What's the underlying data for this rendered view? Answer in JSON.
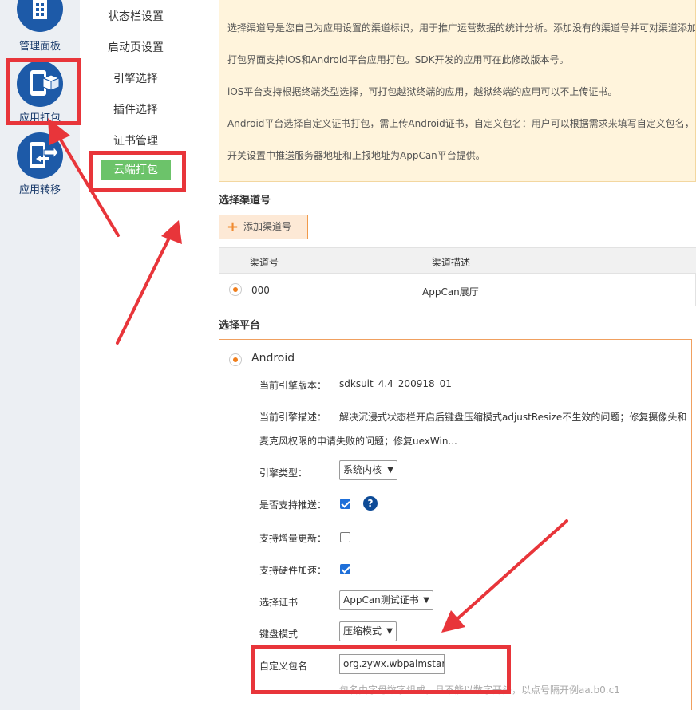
{
  "iconbar": {
    "items": [
      {
        "label": "管理面板",
        "icon": "dashboard-grid-icon"
      },
      {
        "label": "应用打包",
        "icon": "package-phone-icon"
      },
      {
        "label": "应用转移",
        "icon": "transfer-phone-icon"
      }
    ]
  },
  "submenu": {
    "items": [
      "状态栏设置",
      "启动页设置",
      "引擎选择",
      "插件选择",
      "证书管理"
    ],
    "active": "云端打包"
  },
  "notice": {
    "lines": [
      "选择渠道号是您自己为应用设置的渠道标识，用于推广运营数据的统计分析。添加没有的渠道号并可对渠道添加",
      "打包界面支持iOS和Android平台应用打包。SDK开发的应用可在此修改版本号。",
      "iOS平台支持根据终端类型选择，可打包越狱终端的应用，越狱终端的应用可以不上传证书。",
      "Android平台选择自定义证书打包，需上传Android证书，自定义包名：用户可以根据需求来填写自定义包名，",
      "开关设置中推送服务器地址和上报地址为AppCan平台提供。"
    ]
  },
  "channel": {
    "title": "选择渠道号",
    "add_label": "添加渠道号",
    "columns": [
      "渠道号",
      "渠道描述"
    ],
    "rows": [
      {
        "id": "000",
        "desc": "AppCan展厅"
      }
    ]
  },
  "platform": {
    "title": "选择平台",
    "name": "Android",
    "engine_version_label": "当前引擎版本：",
    "engine_version": "sdksuit_4.4_200918_01",
    "engine_desc_label": "当前引擎描述：",
    "engine_desc_line1": "解决沉浸式状态栏开启后键盘压缩模式adjustResize不生效的问题；修复摄像头和",
    "engine_desc_line2": "麦克风权限的申请失败的问题；修复uexWin...",
    "engine_type_label": "引擎类型：",
    "engine_type_value": "系统内核",
    "push_label": "是否支持推送：",
    "push_checked": true,
    "incremental_label": "支持增量更新：",
    "incremental_checked": false,
    "hwaccel_label": "支持硬件加速：",
    "hwaccel_checked": true,
    "cert_label": "选择证书",
    "cert_value": "AppCan测试证书",
    "keyboard_label": "键盘模式",
    "keyboard_value": "压缩模式",
    "package_label": "自定义包名",
    "package_value": "org.zywx.wbpalmstar.",
    "package_hint": "包名由字母数字组成，且不能以数字开头，以点号隔开例aa.b0.c1"
  },
  "colors": {
    "annotation_red": "#e8353a",
    "accent_orange": "#f07d1a",
    "active_green": "#6cc36a",
    "brand_blue": "#1d5aa8"
  }
}
